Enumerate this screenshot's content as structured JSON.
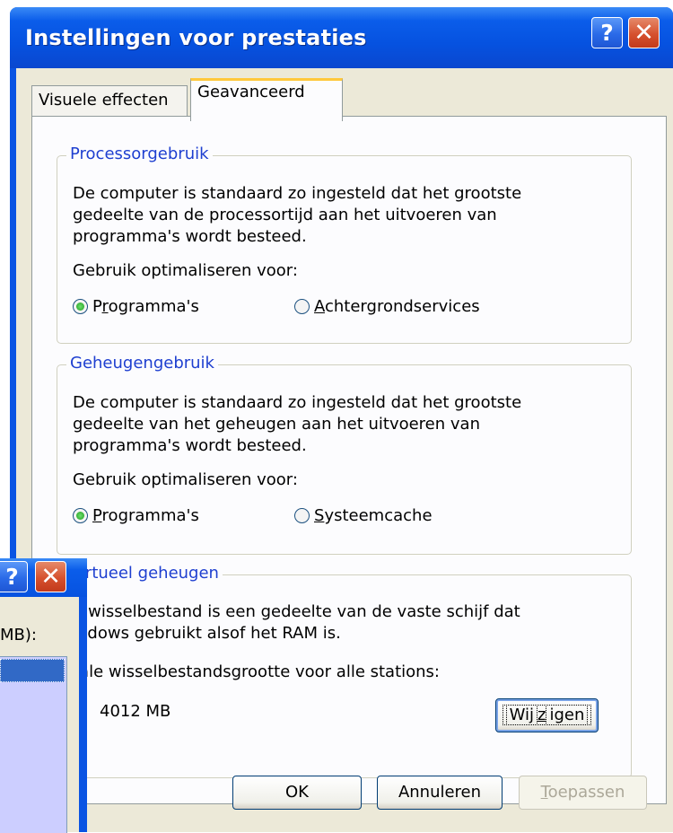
{
  "window": {
    "title": "Instellingen voor prestaties",
    "help_glyph": "?",
    "close_glyph": "✕"
  },
  "tabs": [
    {
      "label": "Visuele effecten",
      "selected": false
    },
    {
      "label": "Geavanceerd",
      "selected": true
    }
  ],
  "processor": {
    "legend": "Processorgebruik",
    "description": [
      "De computer is standaard zo ingesteld dat het grootste",
      "gedeelte van de processortijd aan het uitvoeren van",
      "programma's wordt besteed."
    ],
    "optimize_label": "Gebruik optimaliseren voor:",
    "options": [
      {
        "before": "P",
        "underline": "r",
        "after": "ogramma's",
        "selected": true
      },
      {
        "before": "",
        "underline": "A",
        "after": "chtergrondservices",
        "selected": false
      }
    ]
  },
  "memory": {
    "legend": "Geheugengebruik",
    "description": [
      "De computer is standaard zo ingesteld dat het grootste",
      "gedeelte van het geheugen aan het uitvoeren van",
      "programma's wordt besteed."
    ],
    "optimize_label": "Gebruik optimaliseren voor:",
    "options": [
      {
        "before": "",
        "underline": "P",
        "after": "rogramma's",
        "selected": true
      },
      {
        "before": "",
        "underline": "S",
        "after": "ysteemcache",
        "selected": false
      }
    ]
  },
  "virtual": {
    "legend": "Virtueel geheugen",
    "description": [
      "n wisselbestand is een gedeelte van de vaste schijf dat",
      "indows gebruikt alsof het RAM is."
    ],
    "total_label": "tale wisselbestandsgrootte voor alle stations:",
    "total_value": "4012 MB",
    "change_button": {
      "before": "Wij",
      "underline": "z",
      "after": "igen"
    }
  },
  "buttons": {
    "ok": "OK",
    "cancel": "Annuleren",
    "apply": {
      "before": "",
      "underline": "T",
      "after": "oepassen",
      "disabled": true
    }
  },
  "background_window": {
    "help_glyph": "?",
    "close_glyph": "✕",
    "label": "MB):"
  },
  "colors": {
    "titlebar": "#0a54e3",
    "client": "#ece9d8",
    "legend_text": "#1e3fd0",
    "list_background": "#ccceff",
    "list_selection": "#3169c6"
  }
}
